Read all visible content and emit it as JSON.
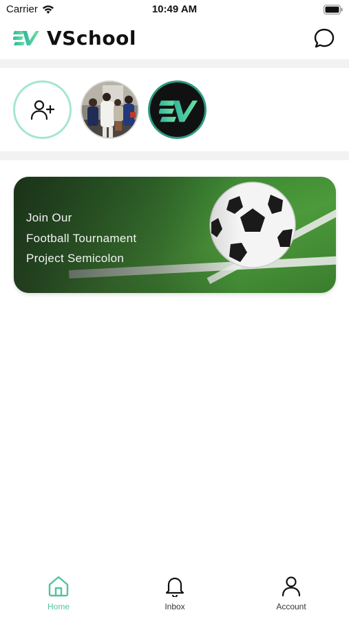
{
  "status_bar": {
    "carrier": "Carrier",
    "time": "10:49 AM"
  },
  "header": {
    "title": "VSchool",
    "icons": [
      "vschool-logo-icon",
      "chat-bubble-icon"
    ]
  },
  "stories": [
    {
      "type": "add",
      "icon": "add-user-icon"
    },
    {
      "type": "photo",
      "description_icon": "group-photo"
    },
    {
      "type": "logo",
      "icon": "vschool-logo-icon"
    }
  ],
  "banner": {
    "lines": [
      "Join Our",
      "Football Tournament",
      "Project Semicolon"
    ]
  },
  "tabbar": {
    "items": [
      {
        "label": "Home",
        "icon": "home-icon",
        "active": true
      },
      {
        "label": "Inbox",
        "icon": "bell-icon",
        "active": false
      },
      {
        "label": "Account",
        "icon": "user-icon",
        "active": false
      }
    ]
  },
  "colors": {
    "accent": "#52c39a",
    "story_ring": "#a4e6d0",
    "logo_ring": "#2d9a80"
  }
}
